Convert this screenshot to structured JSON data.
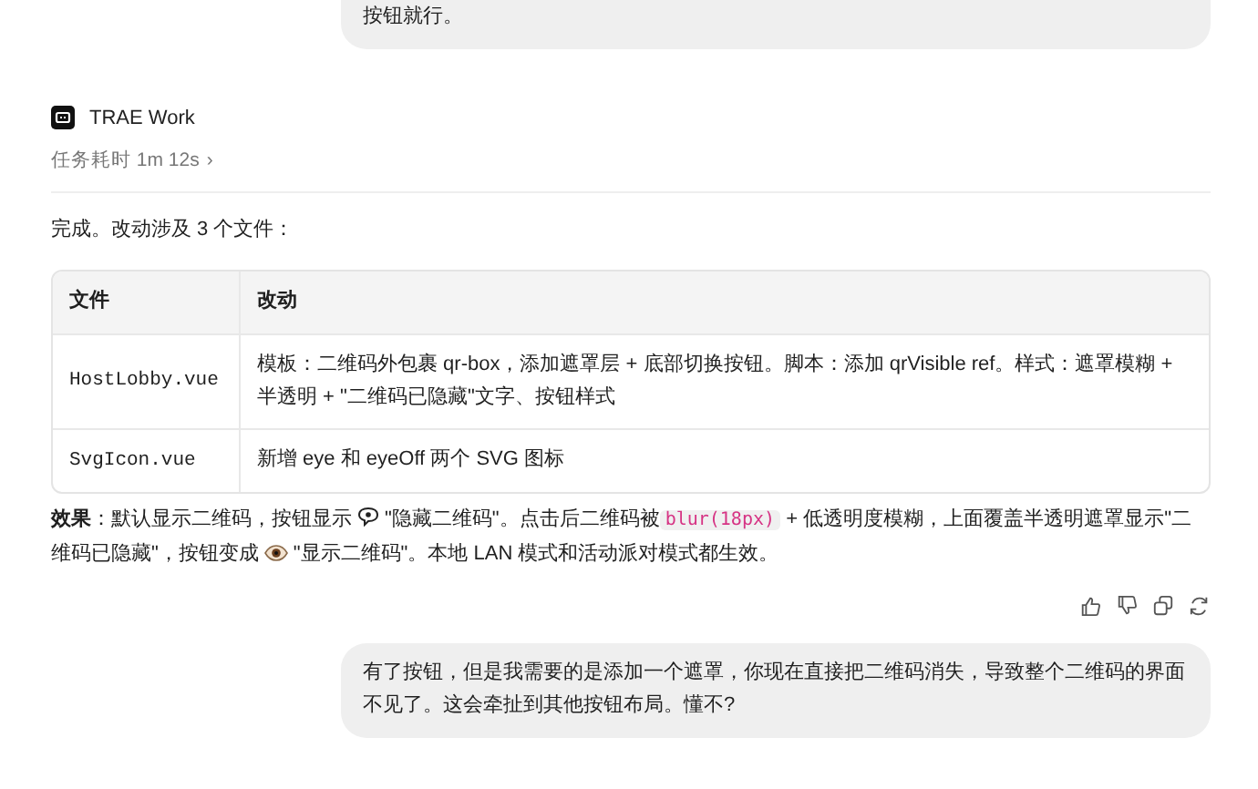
{
  "prev_message": {
    "text": "按钮就行。"
  },
  "agent": {
    "name": "TRAE Work",
    "duration": "任务耗时 1m 12s",
    "chevron": "›"
  },
  "intro": "完成。改动涉及 3 个文件：",
  "table": {
    "columns": [
      "文件",
      "改动"
    ],
    "rows": [
      {
        "file": "HostLobby.vue",
        "change": "模板：二维码外包裹 qr-box，添加遮罩层 + 底部切换按钮。脚本：添加 qrVisible ref。样式：遮罩模糊 + 半透明 + \"二维码已隐藏\"文字、按钮样式"
      },
      {
        "file": "SvgIcon.vue",
        "change": "新增 eye 和 eyeOff 两个 SVG 图标"
      }
    ]
  },
  "effect": [
    {
      "kind": "text",
      "text": "**效果**：默认显示二维码，按钮显示"
    },
    {
      "kind": "icon"
    },
    {
      "kind": "text",
      "text": "\"隐藏二维码\"。点击后二维码被"
    },
    {
      "kind": "code",
      "text": "blur(18px)"
    },
    {
      "kind": "text",
      "text": "+ 低透明度模糊，上面覆盖半透明遮罩显示\"二维码已隐藏\"，按钮变成"
    },
    {
      "kind": "icon"
    },
    {
      "kind": "text",
      "text": "\"显示二维码\"。本地 LAN 模式和活动派对模式都生效。"
    }
  ],
  "user_message": {
    "text": "有了按钮，但是我需要的是添加一个遮罩，你现在直接把二维码消失，导致整个二维码的界面不见了。这会牵扯到其他按钮布局。懂不?"
  }
}
